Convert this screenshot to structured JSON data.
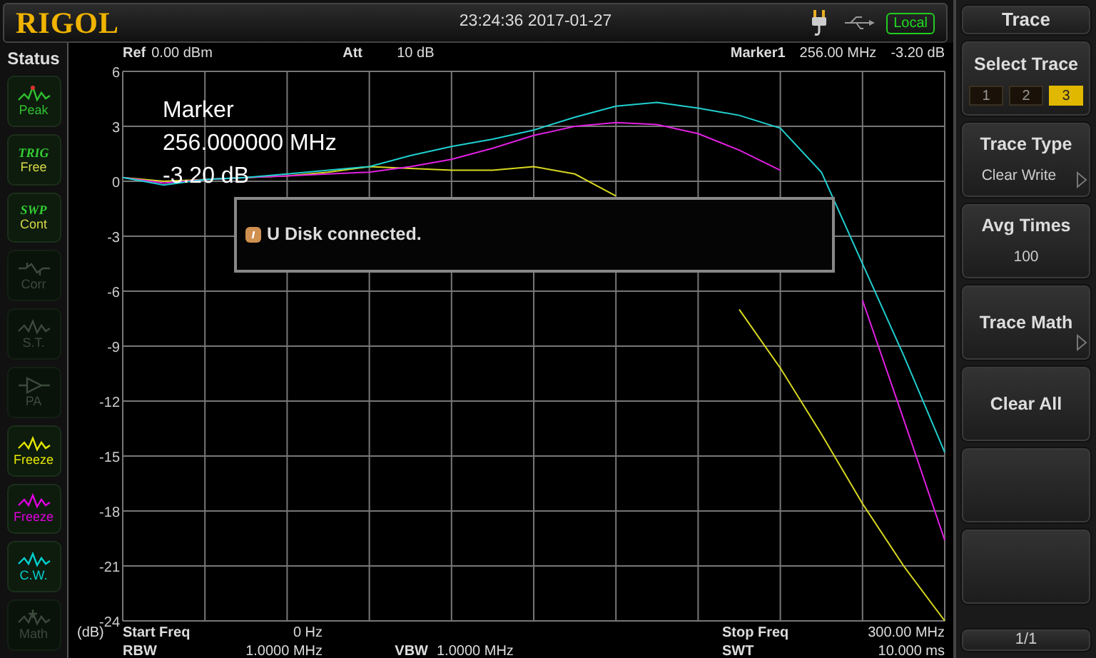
{
  "header": {
    "logo": "RIGOL",
    "datetime": "23:24:36 2017-01-27",
    "mode": "Local"
  },
  "status": {
    "title": "Status",
    "items": [
      {
        "kind": "peak",
        "label": "Peak",
        "color": "#30c030",
        "disabled": false
      },
      {
        "kind": "text",
        "caption": "TRIG",
        "label": "Free",
        "color": "#d8d848",
        "disabled": false
      },
      {
        "kind": "text",
        "caption": "SWP",
        "label": "Cont",
        "color": "#d8d848",
        "disabled": false
      },
      {
        "kind": "corr",
        "label": "Corr",
        "disabled": true
      },
      {
        "kind": "wave",
        "label": "S.T.",
        "disabled": true
      },
      {
        "kind": "amp",
        "label": "PA",
        "disabled": true
      },
      {
        "kind": "wave",
        "label": "Freeze",
        "color": "#e6e600",
        "disabled": false
      },
      {
        "kind": "wave",
        "label": "Freeze",
        "color": "#e000e0",
        "disabled": false
      },
      {
        "kind": "wave",
        "label": "C.W.",
        "color": "#00d0d0",
        "disabled": false
      },
      {
        "kind": "math",
        "label": "Math",
        "disabled": true
      }
    ]
  },
  "readout": {
    "ref_label": "Ref",
    "ref_value": "0.00 dBm",
    "att_label": "Att",
    "att_value": "10 dB",
    "marker_label": "Marker1",
    "marker_freq": "256.00 MHz",
    "marker_level": "-3.20 dB"
  },
  "marker_box": {
    "title": "Marker",
    "freq": "256.000000 MHz",
    "level": "-3.20 dB"
  },
  "message": "U Disk connected.",
  "chart_data": {
    "type": "line",
    "ylabel": "(dB)",
    "categories": [
      null,
      null,
      null,
      null,
      null,
      null,
      null,
      null,
      null,
      null,
      null,
      null,
      null,
      null,
      null,
      null,
      null,
      null,
      null,
      null,
      null
    ],
    "ylim": [
      -24,
      6
    ],
    "grid": true,
    "yticks": [
      6,
      3,
      0,
      -3,
      -6,
      -9,
      -12,
      -15,
      -18,
      -21,
      -24
    ],
    "series": [
      {
        "color": "#d8d820",
        "values": [
          0.2,
          0,
          0.1,
          0.2,
          0.3,
          0.5,
          0.8,
          0.7,
          0.6,
          0.6,
          0.8,
          0.4,
          -0.8,
          null,
          null,
          -7,
          -10.2,
          -13.8,
          -17.6,
          -21,
          -24
        ]
      },
      {
        "color": "#e020e0",
        "values": [
          0.2,
          -0.1,
          0.1,
          0.2,
          0.3,
          0.4,
          0.5,
          0.8,
          1.2,
          1.8,
          2.5,
          3,
          3.2,
          3.1,
          2.6,
          1.7,
          0.6,
          null,
          -6.5,
          -13,
          -19.6
        ]
      },
      {
        "color": "#20d0d0",
        "values": [
          0.2,
          -0.2,
          0.1,
          0.2,
          0.4,
          0.6,
          0.8,
          1.4,
          1.9,
          2.3,
          2.8,
          3.5,
          4.1,
          4.3,
          4,
          3.6,
          2.9,
          0.5,
          -4.5,
          -9.5,
          -14.8
        ]
      }
    ]
  },
  "footer": [
    {
      "label": "Start Freq",
      "value": "0 Hz"
    },
    {
      "label": "Stop Freq",
      "value": "300.00 MHz"
    },
    {
      "label": "RBW",
      "value": "1.0000 MHz"
    },
    {
      "label": "VBW",
      "value": "1.0000 MHz"
    },
    {
      "label": "SWT",
      "value": "10.000 ms"
    }
  ],
  "menu": {
    "title": "Trace",
    "items": [
      {
        "kind": "select",
        "label": "Select Trace",
        "options": [
          {
            "label": "1",
            "selected": false
          },
          {
            "label": "2",
            "selected": false
          },
          {
            "label": "3",
            "selected": true
          }
        ]
      },
      {
        "kind": "value",
        "label": "Trace Type",
        "value": "Clear Write",
        "submenu": true
      },
      {
        "kind": "value",
        "label": "Avg Times",
        "value": "100",
        "submenu": false
      },
      {
        "kind": "value",
        "label": "Trace Math",
        "submenu": true
      },
      {
        "kind": "value",
        "label": "Clear All",
        "submenu": false
      },
      {
        "kind": "empty"
      },
      {
        "kind": "empty"
      }
    ],
    "page": "1/1"
  }
}
